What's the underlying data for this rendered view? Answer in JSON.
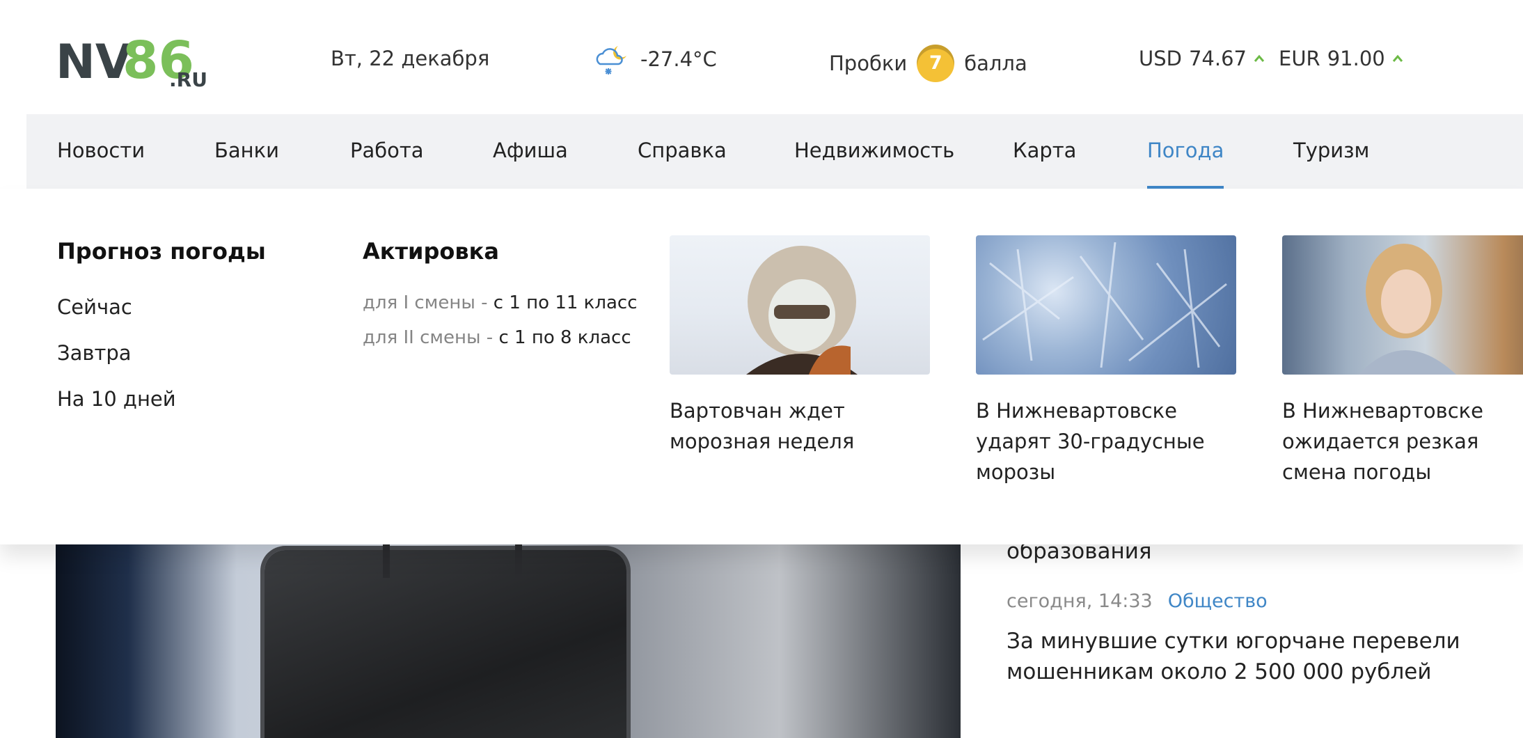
{
  "header": {
    "logo_main": "NV86",
    "logo_suffix": ".RU",
    "date": "Вт, 22 декабря",
    "weather": {
      "icon": "cloud-snow-moon-icon",
      "temperature": "-27.4°C"
    },
    "traffic": {
      "label": "Пробки",
      "score": "7",
      "unit": "балла"
    },
    "currencies": [
      {
        "code": "USD",
        "value": "74.67",
        "trend": "up"
      },
      {
        "code": "EUR",
        "value": "91.00",
        "trend": "up"
      }
    ]
  },
  "nav": {
    "items": [
      "Новости",
      "Банки",
      "Работа",
      "Афиша",
      "Справка",
      "Недвижимость",
      "Карта",
      "Погода",
      "Туризм"
    ],
    "active": "Погода"
  },
  "dropdown": {
    "forecast": {
      "heading": "Прогноз погоды",
      "links": [
        "Сейчас",
        "Завтра",
        "На 10 дней"
      ]
    },
    "aktirovka": {
      "heading": "Актировка",
      "rows": [
        {
          "label": "для I смены - ",
          "value": "с 1 по 11 класс"
        },
        {
          "label": "для II смены - ",
          "value": "с 1 по 8 класс"
        }
      ]
    },
    "cards": [
      {
        "title": "Вартовчан ждет морозная неделя",
        "image": "frozen-person-photo"
      },
      {
        "title": "В Нижневартовске ударят 30-градусные морозы",
        "image": "frost-pattern-photo"
      },
      {
        "title": "В Нижневартовске ожидается резкая смена погоды",
        "image": "woman-headache-photo"
      }
    ]
  },
  "background": {
    "partial_text": "образования",
    "news": {
      "time": "сегодня, 14:33",
      "category": "Общество",
      "title": "За минувшие сутки югорчане перевели мошенникам около 2 500 000 рублей"
    }
  },
  "colors": {
    "accent": "#3f86c6",
    "logo_green": "#7bbf5a",
    "logo_dark": "#3a4347",
    "traffic_badge": "#f4c136",
    "trend_up": "#6cba46",
    "nav_bg": "#f1f2f4"
  }
}
